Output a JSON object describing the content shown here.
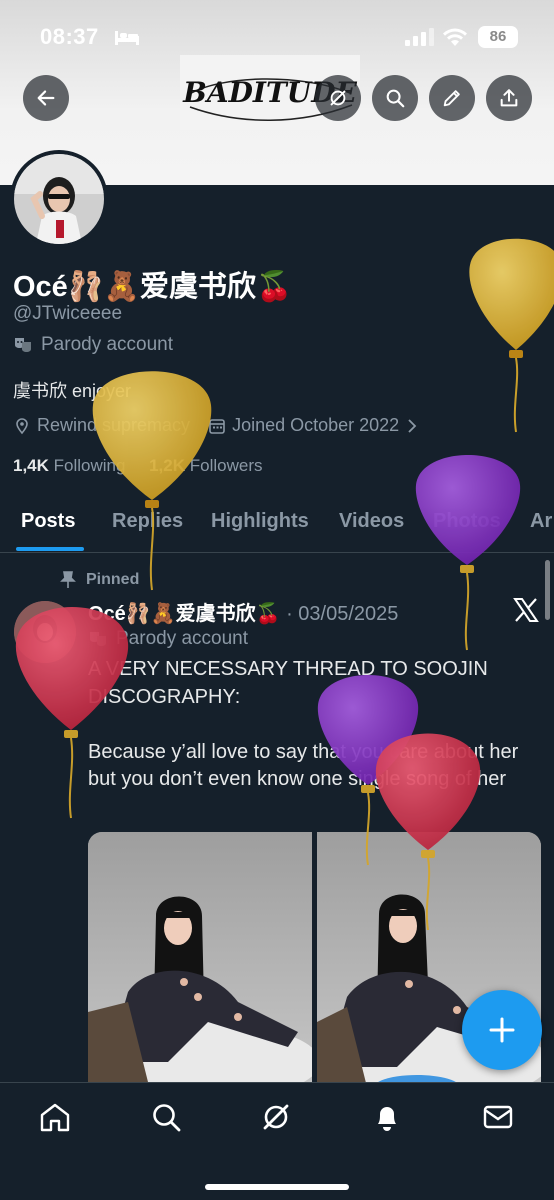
{
  "status_bar": {
    "time": "08:37",
    "battery": "86"
  },
  "header": {
    "banner_logo_text": "BADITUDE"
  },
  "profile": {
    "name": "Océ🩰🧸爱虞书欣🍒",
    "handle": "@JTwiceeee",
    "parody_label": "Parody account",
    "bio": "虞书欣 enjoyer",
    "location": "Rewind supremacy",
    "joined": "Joined October 2022",
    "following_count": "1,4K",
    "following_label": "Following",
    "followers_count": "1,2K",
    "followers_label": "Followers"
  },
  "tabs": [
    "Posts",
    "Replies",
    "Highlights",
    "Videos",
    "Photos",
    "Ar"
  ],
  "post": {
    "pinned_label": "Pinned",
    "author": "Océ🩰🧸爱虞书欣🍒",
    "date": "03/05/2025",
    "parody_label": "Parody account",
    "text": "A VERY NECESSARY THREAD TO SOOJIN DISCOGRAPHY:\n\nBecause y’all love to say that you care about her but you don’t even know one single song of her"
  },
  "colors": {
    "background": "#15202b",
    "accent": "#1d9bf0",
    "balloon_yellow": "#e5b935",
    "balloon_purple": "#8b34c9",
    "balloon_red": "#d9344f"
  },
  "icons": {
    "back": "arrow-left-icon",
    "grok": "grok-icon",
    "search": "search-icon",
    "edit": "pencil-icon",
    "share": "share-icon",
    "nav": [
      "home-icon",
      "search-icon",
      "grok-icon",
      "bell-icon",
      "mail-icon"
    ]
  }
}
